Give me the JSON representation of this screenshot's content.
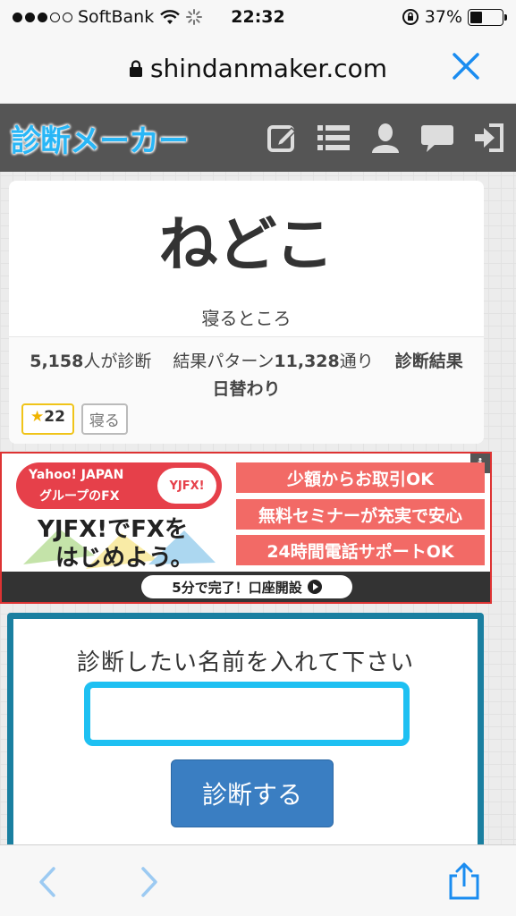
{
  "status_bar": {
    "carrier": "SoftBank",
    "time": "22:32",
    "battery_percent": "37%",
    "battery_level": 0.37,
    "signal_bars_filled": 3,
    "signal_bars_total": 5
  },
  "browser": {
    "url": "shindanmaker.com"
  },
  "site": {
    "logo": "診断メーカー",
    "header_icons": [
      "edit-icon",
      "list-icon",
      "user-icon",
      "chat-icon",
      "login-icon"
    ]
  },
  "shindan": {
    "title": "ねどこ",
    "subtitle": "寝るところ",
    "count": "5,158",
    "count_suffix": "人が診断",
    "patterns_prefix": "結果パターン",
    "patterns": "11,328",
    "patterns_suffix": "通り",
    "daily_label": "診断結果日替わり",
    "stars": "22",
    "tag": "寝る"
  },
  "ad": {
    "info_label": "i",
    "yahoo_line1": "Yahoo! JAPAN",
    "yahoo_line2": "グループのFX",
    "logo": "YJFX!",
    "headline1": "YJFX!でFXを",
    "headline2": "はじめよう。",
    "features": [
      "少額からお取引OK",
      "無料セミナーが充実で安心",
      "24時間電話サポートOK"
    ],
    "cta": "5分で完了！口座開設"
  },
  "form": {
    "label": "診断したい名前を入れて下さい",
    "input_value": "",
    "submit": "診断する"
  },
  "colors": {
    "header_bg": "#555555",
    "logo": "#29b6f6",
    "form_border": "#1a7fa0",
    "input_border": "#1ec0f2",
    "submit_bg": "#3a7ec2",
    "ios_blue": "#1a8cf0",
    "ad_red": "#e6404a"
  }
}
